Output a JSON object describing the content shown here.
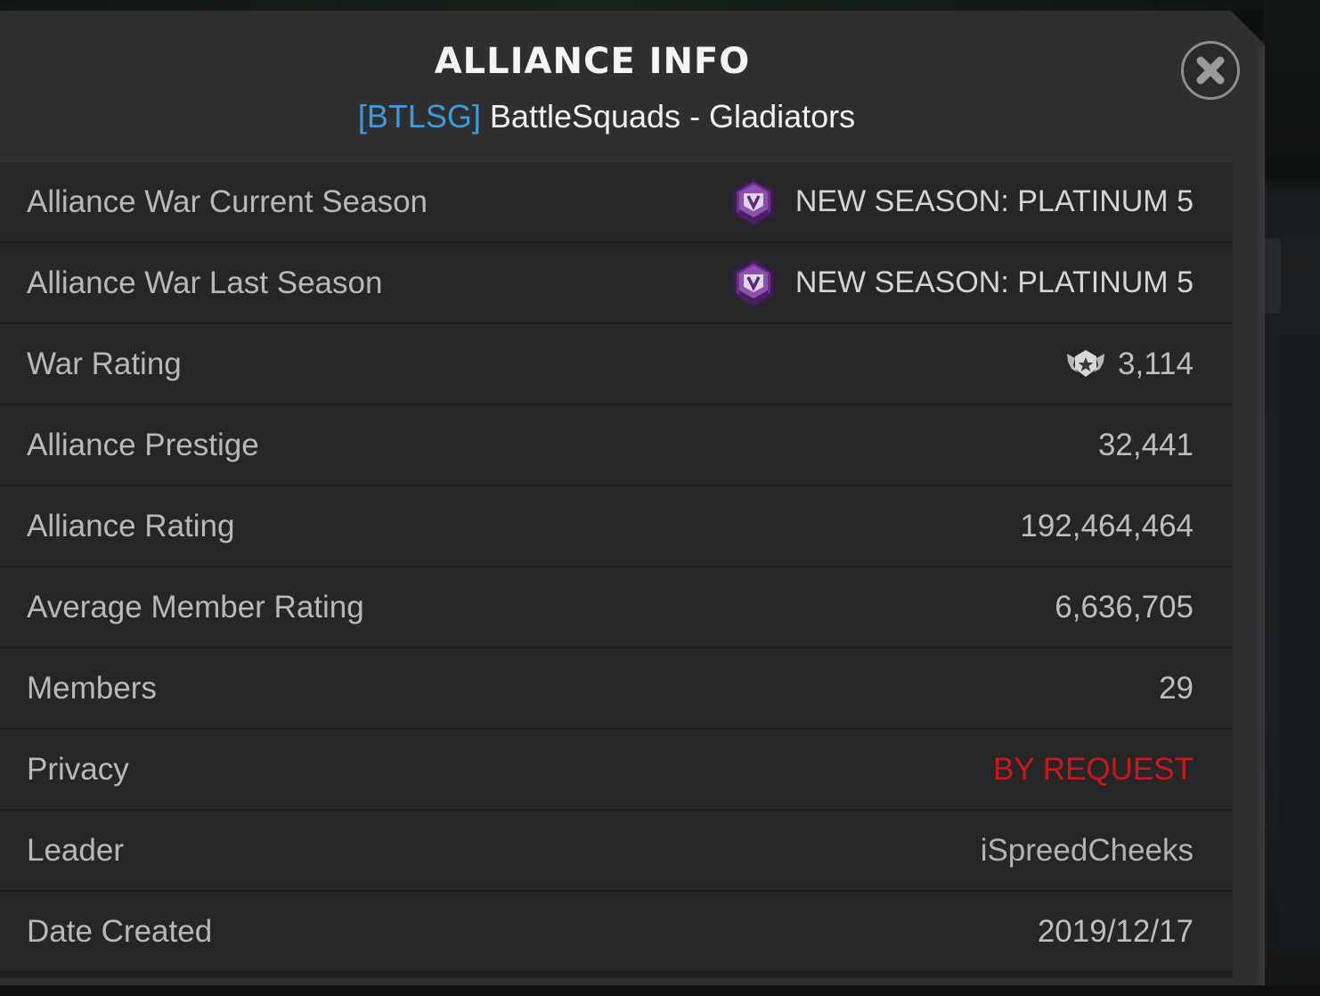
{
  "dialog": {
    "title": "ALLIANCE INFO",
    "tag": "[BTLSG]",
    "name": "BattleSquads - Gladiators",
    "close_icon": "close-x-icon"
  },
  "rows": [
    {
      "label": "Alliance War Current Season",
      "value": "NEW SEASON: PLATINUM 5",
      "icon": "platinum-tier-badge-icon"
    },
    {
      "label": "Alliance War Last Season",
      "value": "NEW SEASON: PLATINUM 5",
      "icon": "platinum-tier-badge-icon"
    },
    {
      "label": "War Rating",
      "value": "3,114",
      "icon": "war-rating-emblem-icon"
    },
    {
      "label": "Alliance Prestige",
      "value": "32,441"
    },
    {
      "label": "Alliance Rating",
      "value": "192,464,464"
    },
    {
      "label": "Average Member Rating",
      "value": "6,636,705"
    },
    {
      "label": "Members",
      "value": "29"
    },
    {
      "label": "Privacy",
      "value": "BY REQUEST"
    },
    {
      "label": "Leader",
      "value": "iSpreedCheeks"
    },
    {
      "label": "Date Created",
      "value": "2019/12/17"
    }
  ],
  "colors": {
    "tag": "#3e9ad8",
    "privacy_value": "#c8181b",
    "badge": "#6a2f86",
    "panel": "#2f2f31",
    "row": "#262628"
  }
}
